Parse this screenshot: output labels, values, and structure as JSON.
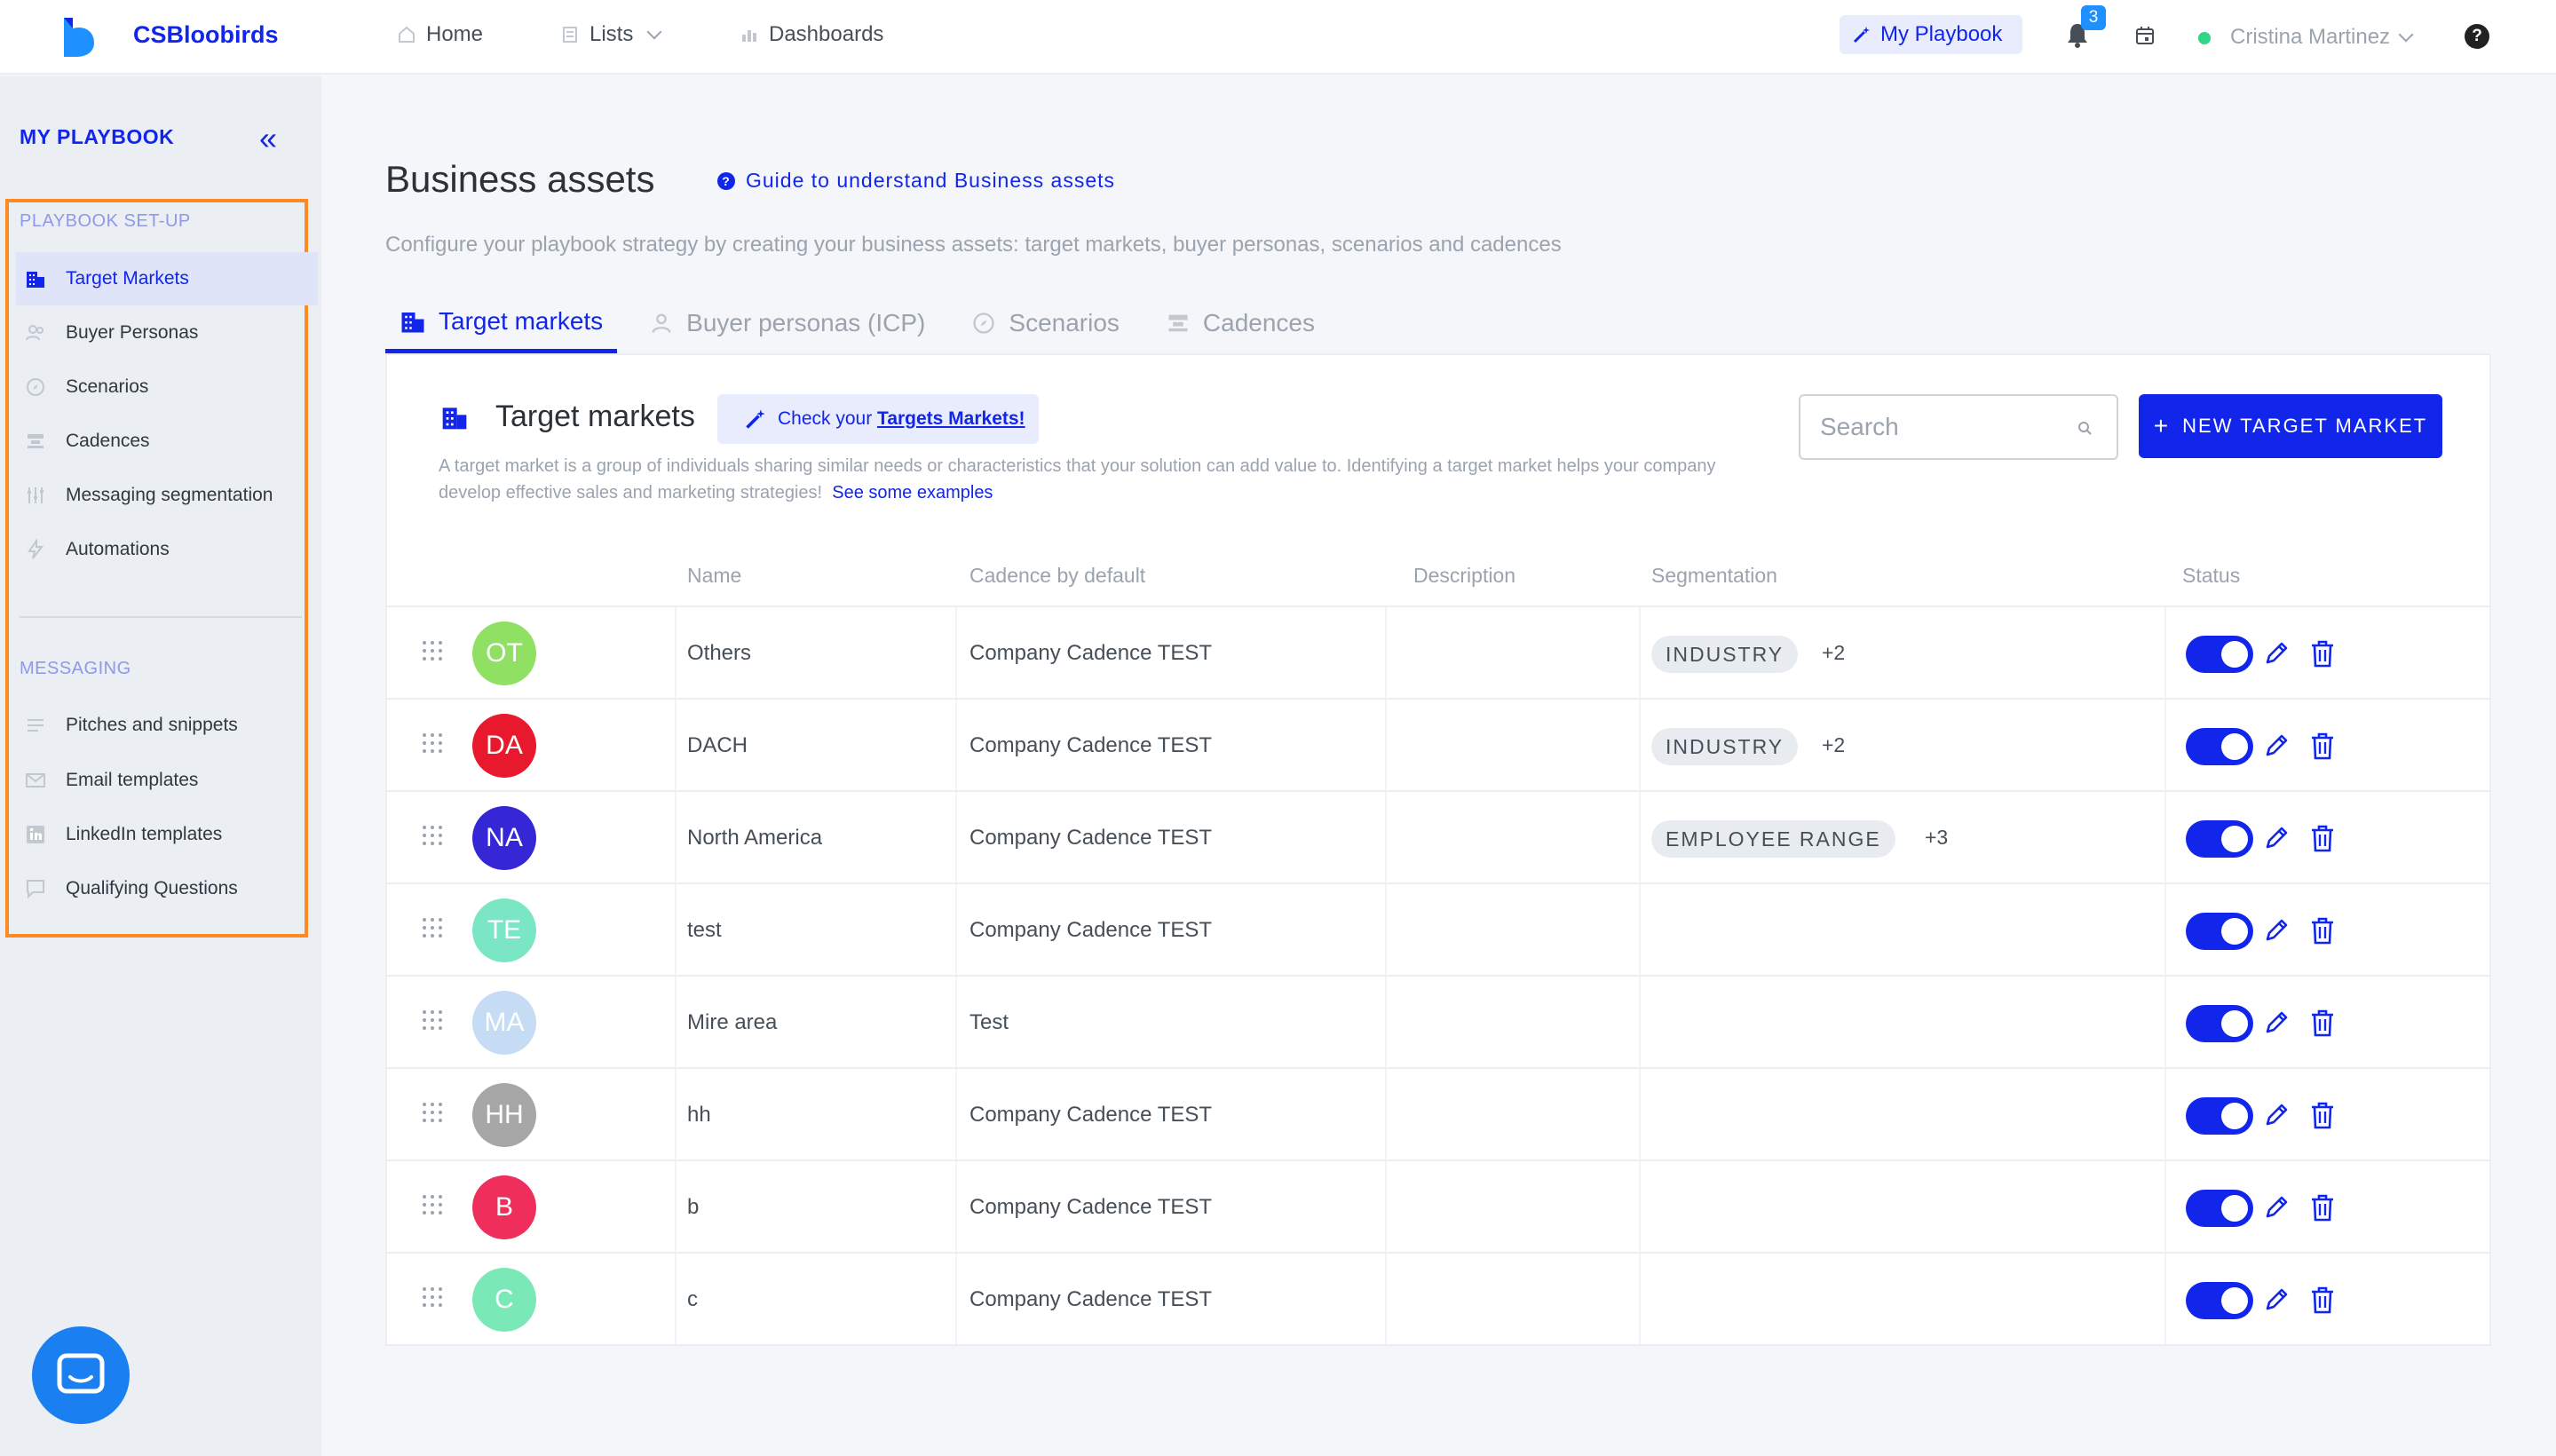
{
  "app": {
    "brand": "CSBloobirds"
  },
  "nav": {
    "home": "Home",
    "lists": "Lists",
    "dashboards": "Dashboards"
  },
  "header": {
    "my_playbook": "My Playbook",
    "notifications_count": "3",
    "user_name": "Cristina Martinez",
    "help": "?"
  },
  "sidebar": {
    "title": "MY PLAYBOOK",
    "section_setup": "PLAYBOOK SET-UP",
    "setup_items": [
      {
        "label": "Target Markets",
        "icon": "building-icon"
      },
      {
        "label": "Buyer Personas",
        "icon": "people-icon"
      },
      {
        "label": "Scenarios",
        "icon": "compass-icon"
      },
      {
        "label": "Cadences",
        "icon": "cadence-icon"
      },
      {
        "label": "Messaging segmentation",
        "icon": "sliders-icon"
      },
      {
        "label": "Automations",
        "icon": "bolt-icon"
      }
    ],
    "section_messaging": "MESSAGING",
    "messaging_items": [
      {
        "label": "Pitches and snippets",
        "icon": "lines-icon"
      },
      {
        "label": "Email templates",
        "icon": "mail-icon"
      },
      {
        "label": "LinkedIn templates",
        "icon": "linkedin-icon"
      },
      {
        "label": "Qualifying Questions",
        "icon": "chat-icon"
      }
    ]
  },
  "page": {
    "title": "Business assets",
    "guide_link": "Guide to understand Business assets",
    "subtitle": "Configure your playbook strategy by creating your business assets: target markets, buyer personas, scenarios and cadences"
  },
  "tabs": [
    "Target markets",
    "Buyer personas (ICP)",
    "Scenarios",
    "Cadences"
  ],
  "card": {
    "title": "Target markets",
    "check_prefix": "Check your ",
    "check_link": "Targets Markets!",
    "description": "A target market is a group of individuals sharing similar needs or characteristics that your solution can add value to. Identifying a target market helps your company develop effective sales and marketing strategies!",
    "examples_link": "See some examples",
    "search_placeholder": "Search",
    "new_button": "NEW TARGET MARKET"
  },
  "table": {
    "headers": {
      "name": "Name",
      "cadence": "Cadence by default",
      "description": "Description",
      "segmentation": "Segmentation",
      "status": "Status"
    },
    "rows": [
      {
        "initials": "OT",
        "color": "#8fe063",
        "name": "Others",
        "cadence": "Company Cadence TEST",
        "tag": "INDUSTRY",
        "extra": "+2",
        "active": true
      },
      {
        "initials": "DA",
        "color": "#e8192c",
        "name": "DACH",
        "cadence": "Company Cadence TEST",
        "tag": "INDUSTRY",
        "extra": "+2",
        "active": true
      },
      {
        "initials": "NA",
        "color": "#3526d6",
        "name": "North America",
        "cadence": "Company Cadence TEST",
        "tag": "EMPLOYEE RANGE",
        "extra": "+3",
        "active": true
      },
      {
        "initials": "TE",
        "color": "#7ae6c4",
        "name": "test",
        "cadence": "Company Cadence TEST",
        "tag": "",
        "extra": "",
        "active": true
      },
      {
        "initials": "MA",
        "color": "#c6dcf5",
        "name": "Mire area",
        "cadence": "Test",
        "tag": "",
        "extra": "",
        "active": true
      },
      {
        "initials": "HH",
        "color": "#a6a6a6",
        "name": "hh",
        "cadence": "Company Cadence TEST",
        "tag": "",
        "extra": "",
        "active": true
      },
      {
        "initials": "B",
        "color": "#ef2e5c",
        "name": "b",
        "cadence": "Company Cadence TEST",
        "tag": "",
        "extra": "",
        "active": true
      },
      {
        "initials": "C",
        "color": "#7be8b8",
        "name": "c",
        "cadence": "Company Cadence TEST",
        "tag": "",
        "extra": "",
        "active": true
      }
    ]
  }
}
